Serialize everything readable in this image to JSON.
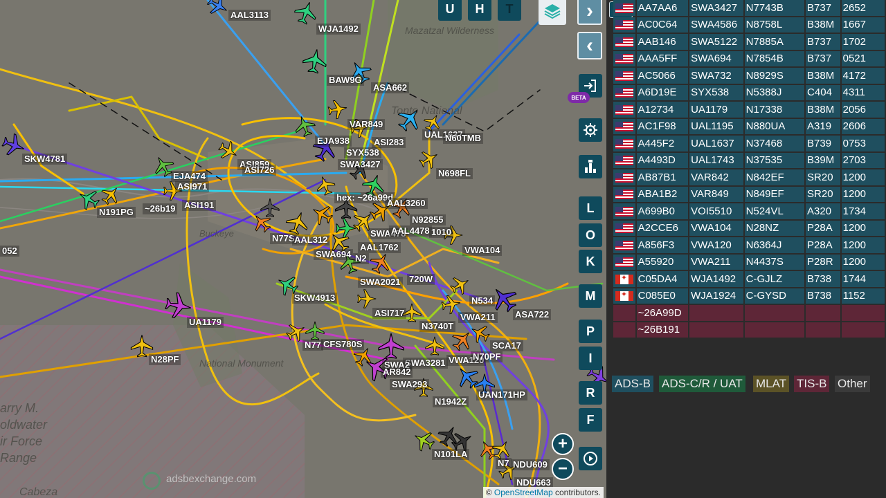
{
  "map": {
    "place_labels": [
      "Mazatzal Wilderness",
      "Tonto National",
      "National Monument",
      "arry M.",
      "oldwater",
      "ir Force",
      "Range",
      "Cabeza",
      "Buckeye"
    ],
    "watermark": "adsbexchange.com",
    "attribution": {
      "symbol": "©",
      "link": "OpenStreetMap",
      "text": "contributors."
    },
    "aircraft_labels": [
      "AAL3113",
      "WJA1492",
      "BAW9G",
      "ASA662",
      "VAR849",
      "UAL1637",
      "N60TMB",
      "EJA938",
      "ASI283",
      "SYX538",
      "SWA3427",
      "ASI859",
      "ASI726",
      "EJA474",
      "ASI971",
      "N698FL",
      "hex: ~26a99d",
      "AAL3260",
      "~26b19",
      "ASI191",
      "N191PG",
      "SKW4781",
      "N92855",
      "N77S",
      "AAL312",
      "SWA478",
      "AAL4478",
      "1010",
      "AAL1762",
      "N2",
      "SWA694",
      "VWA104",
      "052",
      "SWA2021",
      "720W",
      "SKW4913",
      "N534",
      "ASA722",
      "ASI717",
      "UA1179",
      "N3740T",
      "VWA211",
      "N77",
      "CFS780S",
      "SCA17",
      "N28PF",
      "SWA3281",
      "VWA120",
      "N70PF",
      "SWA2",
      "AR842",
      "SWA293",
      "N1942Z",
      "UAN171HP",
      "N101LA",
      "NDU609",
      "N7",
      "NDU663"
    ]
  },
  "buttons": {
    "u": "U",
    "h": "H",
    "t": "T",
    "layers": "layers-icon",
    "next": "›",
    "prev": "‹",
    "beta": "BETA",
    "l": "L",
    "o": "O",
    "k": "K",
    "m": "M",
    "p": "P",
    "i": "I",
    "r": "R",
    "f": "F",
    "zoom_in": "+",
    "zoom_out": "−",
    "toggle": "◂▸"
  },
  "aircraft_table": [
    {
      "flag": "us",
      "hex": "AA7AA6",
      "callsign": "SWA3427",
      "reg": "N7743B",
      "type": "B737",
      "squawk": "2652"
    },
    {
      "flag": "us",
      "hex": "AC0C64",
      "callsign": "SWA4586",
      "reg": "N8758L",
      "type": "B38M",
      "squawk": "1667"
    },
    {
      "flag": "us",
      "hex": "AAB146",
      "callsign": "SWA5122",
      "reg": "N7885A",
      "type": "B737",
      "squawk": "1702"
    },
    {
      "flag": "us",
      "hex": "AAA5FF",
      "callsign": "SWA694",
      "reg": "N7854B",
      "type": "B737",
      "squawk": "0521"
    },
    {
      "flag": "us",
      "hex": "AC5066",
      "callsign": "SWA732",
      "reg": "N8929S",
      "type": "B38M",
      "squawk": "4172"
    },
    {
      "flag": "us",
      "hex": "A6D19E",
      "callsign": "SYX538",
      "reg": "N5388J",
      "type": "C404",
      "squawk": "4311"
    },
    {
      "flag": "us",
      "hex": "A12734",
      "callsign": "UA1179",
      "reg": "N17338",
      "type": "B38M",
      "squawk": "2056"
    },
    {
      "flag": "us",
      "hex": "AC1F98",
      "callsign": "UAL1195",
      "reg": "N880UA",
      "type": "A319",
      "squawk": "2606"
    },
    {
      "flag": "us",
      "hex": "A445F2",
      "callsign": "UAL1637",
      "reg": "N37468",
      "type": "B739",
      "squawk": "0753"
    },
    {
      "flag": "us",
      "hex": "A4493D",
      "callsign": "UAL1743",
      "reg": "N37535",
      "type": "B39M",
      "squawk": "2703"
    },
    {
      "flag": "us",
      "hex": "AB87B1",
      "callsign": "VAR842",
      "reg": "N842EF",
      "type": "SR20",
      "squawk": "1200"
    },
    {
      "flag": "us",
      "hex": "ABA1B2",
      "callsign": "VAR849",
      "reg": "N849EF",
      "type": "SR20",
      "squawk": "1200"
    },
    {
      "flag": "us",
      "hex": "A699B0",
      "callsign": "VOI5510",
      "reg": "N524VL",
      "type": "A320",
      "squawk": "1734"
    },
    {
      "flag": "us",
      "hex": "A2CCE6",
      "callsign": "VWA104",
      "reg": "N28NZ",
      "type": "P28A",
      "squawk": "1200"
    },
    {
      "flag": "us",
      "hex": "A856F3",
      "callsign": "VWA120",
      "reg": "N6364J",
      "type": "P28A",
      "squawk": "1200"
    },
    {
      "flag": "us",
      "hex": "A55920",
      "callsign": "VWA211",
      "reg": "N4437S",
      "type": "P28R",
      "squawk": "1200"
    },
    {
      "flag": "ca",
      "hex": "C05DA4",
      "callsign": "WJA1492",
      "reg": "C-GJLZ",
      "type": "B738",
      "squawk": "1744"
    },
    {
      "flag": "ca",
      "hex": "C085E0",
      "callsign": "WJA1924",
      "reg": "C-GYSD",
      "type": "B738",
      "squawk": "1152"
    },
    {
      "flag": "",
      "hex": "~26A99D",
      "callsign": "",
      "reg": "",
      "type": "",
      "squawk": "",
      "tisb": true
    },
    {
      "flag": "",
      "hex": "~26B191",
      "callsign": "",
      "reg": "",
      "type": "",
      "squawk": "",
      "tisb": true
    }
  ],
  "legend": [
    {
      "label": "ADS-B",
      "color": "#1f4f5f"
    },
    {
      "label": "ADS-C/R / UAT",
      "color": "#1f5a3a"
    },
    {
      "label": "MLAT",
      "color": "#5b5226"
    },
    {
      "label": "TIS-B",
      "color": "#5e2637"
    },
    {
      "label": "Other",
      "color": "#3a3a3a"
    }
  ]
}
